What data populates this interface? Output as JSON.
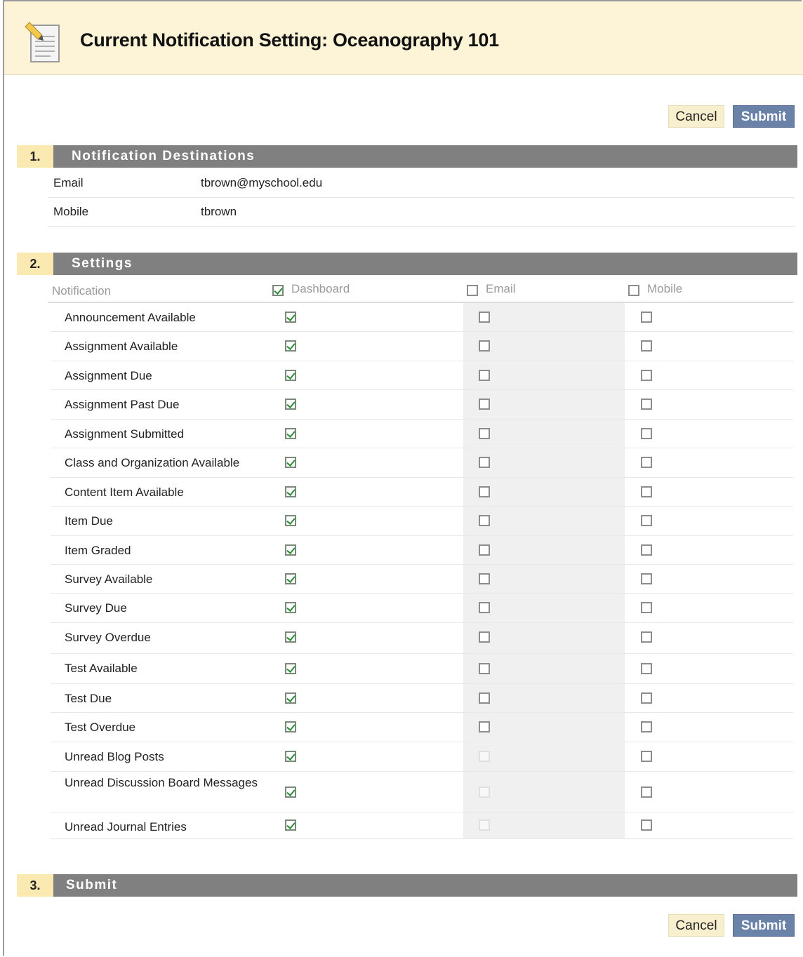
{
  "header": {
    "title": "Current Notification Setting: Oceanography 101",
    "icon": "document-edit-icon"
  },
  "actions": {
    "cancel_label": "Cancel",
    "submit_label": "Submit"
  },
  "steps": [
    {
      "number": "1.",
      "title": "Notification Destinations"
    },
    {
      "number": "2.",
      "title": "Settings"
    },
    {
      "number": "3.",
      "title": "Submit"
    }
  ],
  "destinations": [
    {
      "label": "Email",
      "value": "tbrown@myschool.edu"
    },
    {
      "label": "Mobile",
      "value": "tbrown"
    }
  ],
  "settings": {
    "columns": {
      "notification": "Notification",
      "dashboard": {
        "label": "Dashboard",
        "all_checked": true
      },
      "email": {
        "label": "Email",
        "all_checked": false
      },
      "mobile": {
        "label": "Mobile",
        "all_checked": false
      }
    },
    "rows": [
      {
        "label": "Announcement Available",
        "dashboard": true,
        "email": false,
        "email_disabled": false,
        "mobile": false
      },
      {
        "label": "Assignment Available",
        "dashboard": true,
        "email": false,
        "email_disabled": false,
        "mobile": false
      },
      {
        "label": "Assignment Due",
        "dashboard": true,
        "email": false,
        "email_disabled": false,
        "mobile": false
      },
      {
        "label": "Assignment Past Due",
        "dashboard": true,
        "email": false,
        "email_disabled": false,
        "mobile": false
      },
      {
        "label": "Assignment Submitted",
        "dashboard": true,
        "email": false,
        "email_disabled": false,
        "mobile": false
      },
      {
        "label": "Class and Organization Available",
        "dashboard": true,
        "email": false,
        "email_disabled": false,
        "mobile": false
      },
      {
        "label": "Content Item Available",
        "dashboard": true,
        "email": false,
        "email_disabled": false,
        "mobile": false
      },
      {
        "label": "Item Due",
        "dashboard": true,
        "email": false,
        "email_disabled": false,
        "mobile": false
      },
      {
        "label": "Item Graded",
        "dashboard": true,
        "email": false,
        "email_disabled": false,
        "mobile": false
      },
      {
        "label": "Survey Available",
        "dashboard": true,
        "email": false,
        "email_disabled": false,
        "mobile": false
      },
      {
        "label": "Survey Due",
        "dashboard": true,
        "email": false,
        "email_disabled": false,
        "mobile": false
      },
      {
        "label": "Survey Overdue",
        "dashboard": true,
        "email": false,
        "email_disabled": false,
        "mobile": false
      },
      {
        "label": "Test Available",
        "dashboard": true,
        "email": false,
        "email_disabled": false,
        "mobile": false
      },
      {
        "label": "Test Due",
        "dashboard": true,
        "email": false,
        "email_disabled": false,
        "mobile": false
      },
      {
        "label": "Test Overdue",
        "dashboard": true,
        "email": false,
        "email_disabled": false,
        "mobile": false
      },
      {
        "label": "Unread Blog Posts",
        "dashboard": true,
        "email": false,
        "email_disabled": true,
        "mobile": false
      },
      {
        "label": "Unread Discussion Board Messages",
        "dashboard": true,
        "email": false,
        "email_disabled": true,
        "mobile": false
      },
      {
        "label": "Unread Journal Entries",
        "dashboard": true,
        "email": false,
        "email_disabled": true,
        "mobile": false
      }
    ]
  },
  "colors": {
    "title_bg": "#fdf3d6",
    "step_bar": "#808080",
    "step_num_bg": "#fbe9b2",
    "submit_btn": "#6b82a8",
    "check_green": "#2e8b3a"
  }
}
